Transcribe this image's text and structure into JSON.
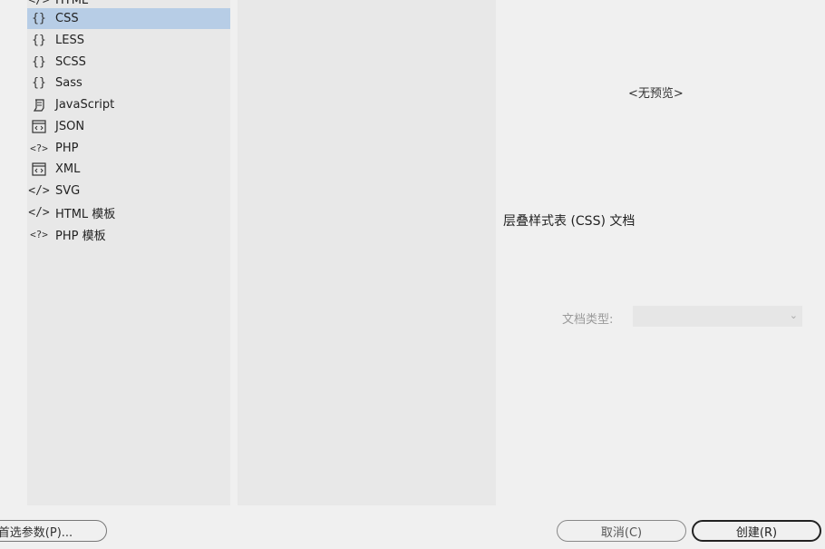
{
  "left_list": {
    "items": [
      {
        "icon": "html-icon",
        "label": "HTML"
      },
      {
        "icon": "braces-icon",
        "label": "CSS",
        "selected": true
      },
      {
        "icon": "braces-icon",
        "label": "LESS"
      },
      {
        "icon": "braces-icon",
        "label": "SCSS"
      },
      {
        "icon": "braces-icon",
        "label": "Sass"
      },
      {
        "icon": "script-icon",
        "label": "JavaScript"
      },
      {
        "icon": "code-window-icon",
        "label": "JSON"
      },
      {
        "icon": "php-icon",
        "label": "PHP"
      },
      {
        "icon": "code-window-icon",
        "label": "XML"
      },
      {
        "icon": "code-tag-icon",
        "label": "SVG"
      },
      {
        "icon": "code-tag-icon",
        "label": "HTML 模板"
      },
      {
        "icon": "php-icon",
        "label": "PHP 模板"
      }
    ],
    "selected_color": "#b7cde6"
  },
  "preview": {
    "text": "<无预览>"
  },
  "description": {
    "text": "层叠样式表 (CSS) 文档"
  },
  "doctype": {
    "label": "文档类型:",
    "value": ""
  },
  "buttons": {
    "prefs": "首选参数(P)...",
    "cancel": "取消(C)",
    "create": "创建(R)"
  }
}
